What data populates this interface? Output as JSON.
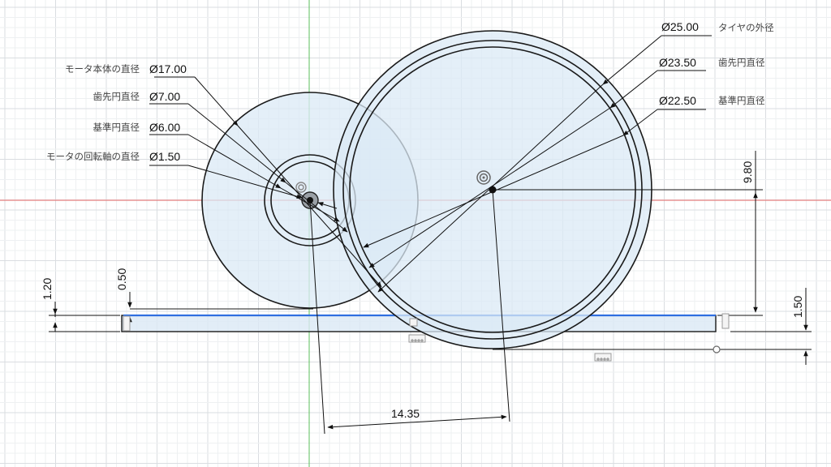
{
  "theme": {
    "sketch_fill": "#dbe9f5",
    "selection_color": "#2f6fe0",
    "x_axis_color": "#e06060",
    "y_axis_color": "#5bbf5b"
  },
  "annotations": {
    "motor_body_dia": {
      "label": "モータ本体の直径",
      "value": "Ø17.00"
    },
    "small_tip_dia": {
      "label": "歯先円直径",
      "value": "Ø7.00"
    },
    "small_ref_dia": {
      "label": "基準円直径",
      "value": "Ø6.00"
    },
    "shaft_dia": {
      "label": "モータの回転軸の直径",
      "value": "Ø1.50"
    },
    "tire_outer_dia": {
      "label": "タイヤの外径",
      "value": "Ø25.00"
    },
    "large_tip_dia": {
      "label": "歯先円直径",
      "value": "Ø23.50"
    },
    "large_ref_dia": {
      "label": "基準円直径",
      "value": "Ø22.50"
    }
  },
  "dimensions": {
    "plate_thickness": "1.20",
    "plate_gap": "0.50",
    "center_distance": "14.35",
    "gear_height": "9.80",
    "ground_clearance": "1.50"
  },
  "icons": {
    "constraint": "tangent-constraint-icon",
    "origin": "sketch-point-icon"
  }
}
